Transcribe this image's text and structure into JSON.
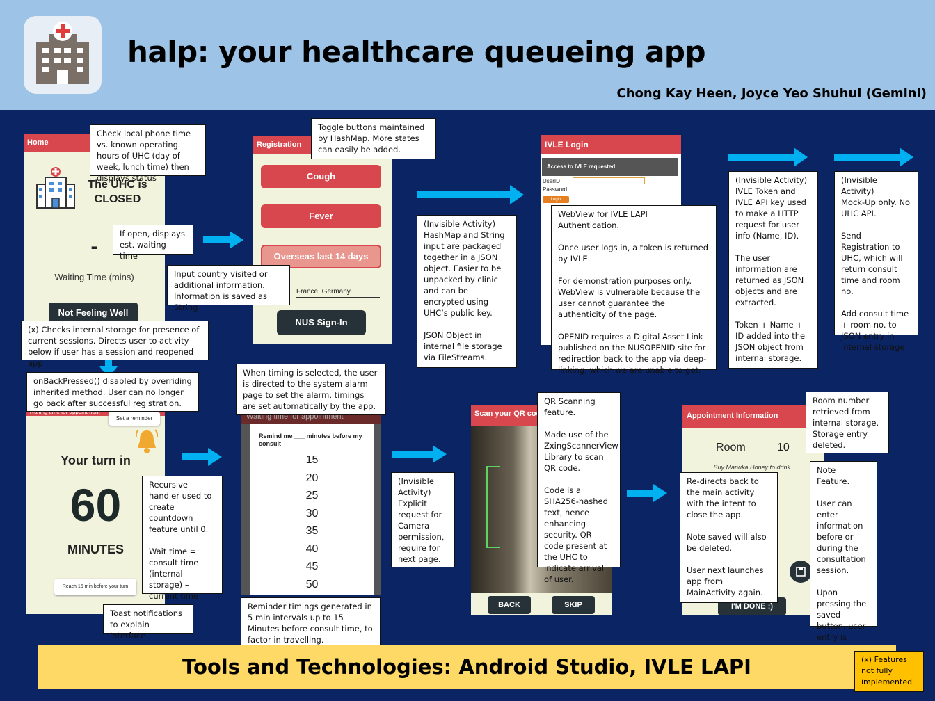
{
  "header": {
    "title": "halp: your healthcare queueing app",
    "authors": "Chong Kay Heen, Joyce Yeo Shuhui (Gemini)",
    "logo_icon": "hospital-icon"
  },
  "home": {
    "bar": "Home",
    "status_line1": "The UHC is",
    "status_line2": "CLOSED",
    "dash": "-",
    "waiting_label": "Waiting Time (mins)",
    "button": "Not Feeling Well"
  },
  "registration": {
    "bar": "Registration",
    "buttons": [
      "Cough",
      "Fever",
      "Overseas last 14 days"
    ],
    "input_value": "France, Germany",
    "signin": "NUS Sign-In"
  },
  "ivle": {
    "bar": "IVLE Login",
    "panel_header": "Access to IVLE requested",
    "userid_label": "UserID",
    "password_label": "Password",
    "login": "Login"
  },
  "turn": {
    "header": "Waiting time for appointment",
    "reminder_button": "Set a reminder",
    "turn_text": "Your turn in",
    "number": "60",
    "unit": "MINUTES",
    "bottom_button": "Reach 15 min before your turn"
  },
  "reminder": {
    "header": "Waiting time for appointment",
    "prompt": "Remind me ___ minutes before my consult",
    "options": [
      "15",
      "20",
      "25",
      "30",
      "35",
      "40",
      "45",
      "50"
    ]
  },
  "qr": {
    "bar": "Scan your QR code",
    "back": "BACK",
    "skip": "SKIP"
  },
  "appointment": {
    "bar": "Appointment Information",
    "room_label": "Room",
    "room_number": "10",
    "note": "Buy Manuka Honey to drink.",
    "done": "I'M DONE :)"
  },
  "notes": {
    "n1": "Check local phone time vs. known operating hours of UHC (day of week,   lunch time) then displays status",
    "n2": "If open, displays est. waiting time",
    "n3": "Input country visited or additional information. Information is saved as String",
    "n4": "Toggle buttons maintained by HashMap. More states can easily be added.",
    "n5": "(Invisible Activity)\nHashMap and String input are packaged together  in a JSON object. Easier to be unpacked by clinic and can be encrypted using UHC’s public key.\n\nJSON Object in internal file storage via FileStreams.",
    "n6": "WebView for IVLE LAPI Authentication.\n\nOnce user logs in, a token  is returned by IVLE.\n\nFor demonstration purposes only. WebView is vulnerable because the user cannot guarantee the  authenticity of the page.\n\nOPENID requires a Digital Asset Link published on the NUSOPENID  site for redirection back to the app via deep-linking, which we are unable to get.",
    "n7": "(Invisible Activity)\nIVLE Token and IVLE API key used to make a HTTP request for user info (Name,  ID).\n\nThe user information are returned as JSON objects and are extracted.\n\nToken + Name + ID added into the JSON object from internal storage.",
    "n8": "(Invisible Activity)\nMock-Up only. No UHC API.\n\nSend Registration to UHC,  which will return consult time and room no.\n\nAdd consult time + room no. to JSON entry in internal storage.",
    "n9": "(x) Checks internal storage for presence of current sessions. Directs user to activity below if user has a session and reopened app",
    "n10": "onBackPressed() disabled by overriding inherited method.  User can no longer go back after successful registration.",
    "n11": "Recursive handler used to create countdown feature until 0.\n\nWait time = consult time (internal storage) – current time",
    "n12": "Toast notifications to explain interface.",
    "n13": "When timing is selected, the user is directed to the system alarm page to set the alarm, timings are set automatically by the app.",
    "n14": "Reminder timings generated  in 5 min intervals up to 15 Minutes before consult time, to factor in travelling.",
    "n15": "(Invisible Activity)\nExplicit request for Camera permission, require for next page.",
    "n16": "QR Scanning feature.\n\nMade use of the ZxingScannerView Library to scan QR code.\n\nCode is a SHA256-hashed text, hence enhancing security. QR code present at the UHC to indicate arrival of user.",
    "n17": "Room number retrieved from internal storage. Storage entry deleted.",
    "n18": "Re-directs back to the main activity with the intent to close the app.\n\nNote  saved will also be deleted.\n\nUser next launches app from MainActivity again.",
    "n19": "Note  Feature.\n\nUser can enter information before or during the consultation session.\n\nUpon pressing the saved button, user entry is saved."
  },
  "footer": {
    "tools": "Tools and Technologies: Android Studio, IVLE LAPI",
    "legend": "(x) Features not fully implemented"
  },
  "colors": {
    "header_bg": "#9dc3e6",
    "page_bg": "#0b2463",
    "app_red": "#d8474d",
    "arrow": "#00b0f0",
    "footer_bg": "#ffd966",
    "legend_bg": "#ffc000"
  }
}
